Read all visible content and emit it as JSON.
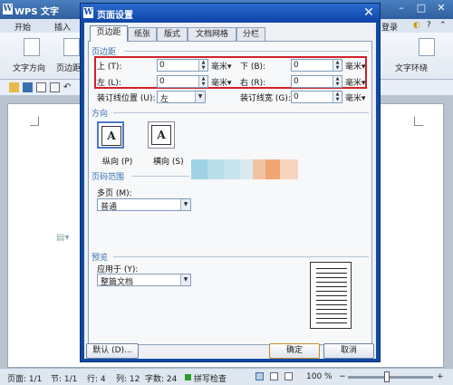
{
  "app": {
    "title": "WPS 文字",
    "menu": [
      "开始",
      "插入"
    ],
    "menu_right": "登录",
    "ribbon_left": [
      "文字方向",
      "页边距"
    ],
    "ribbon_right": "文字环绕",
    "status": {
      "page": "页面: 1/1",
      "section": "节: 1/1",
      "row": "行: 4",
      "col": "列: 12",
      "chars": "字数: 24",
      "spell": "拼写检查",
      "zoom": "100 %",
      "zoom_minus": "−",
      "zoom_plus": "+"
    }
  },
  "dialog": {
    "title": "页面设置",
    "close": "✕",
    "tabs": [
      "页边距",
      "纸张",
      "版式",
      "文档网格",
      "分栏"
    ],
    "active_tab": 0,
    "margins_section": "页边距",
    "top_label": "上 (T):",
    "top_value": "0",
    "top_unit": "毫米▾",
    "bottom_label": "下 (B):",
    "bottom_value": "0",
    "bottom_unit": "毫米▾",
    "left_label": "左 (L):",
    "left_value": "0",
    "left_unit": "毫米▾",
    "right_label": "右 (R):",
    "right_value": "0",
    "right_unit": "毫米▾",
    "gutter_pos_label": "装订线位置 (U):",
    "gutter_pos_value": "左",
    "gutter_width_label": "装订线宽 (G):",
    "gutter_width_value": "0",
    "gutter_width_unit": "毫米▾",
    "orientation_section": "方向",
    "portrait_label": "纵向 (P)",
    "landscape_label": "横向 (S)",
    "orient_glyph": "A",
    "pages_section": "页码范围",
    "multi_page_label": "多页 (M):",
    "multi_page_value": "普通",
    "preview_section": "预览",
    "apply_label": "应用于 (Y):",
    "apply_value": "整篇文档",
    "default_button": "默认 (D)...",
    "ok_button": "确定",
    "cancel_button": "取消"
  },
  "colors": {
    "highlight": "#d0212a",
    "dialog_frame": "#0f4aa5",
    "section_title": "#3a6fb0"
  }
}
